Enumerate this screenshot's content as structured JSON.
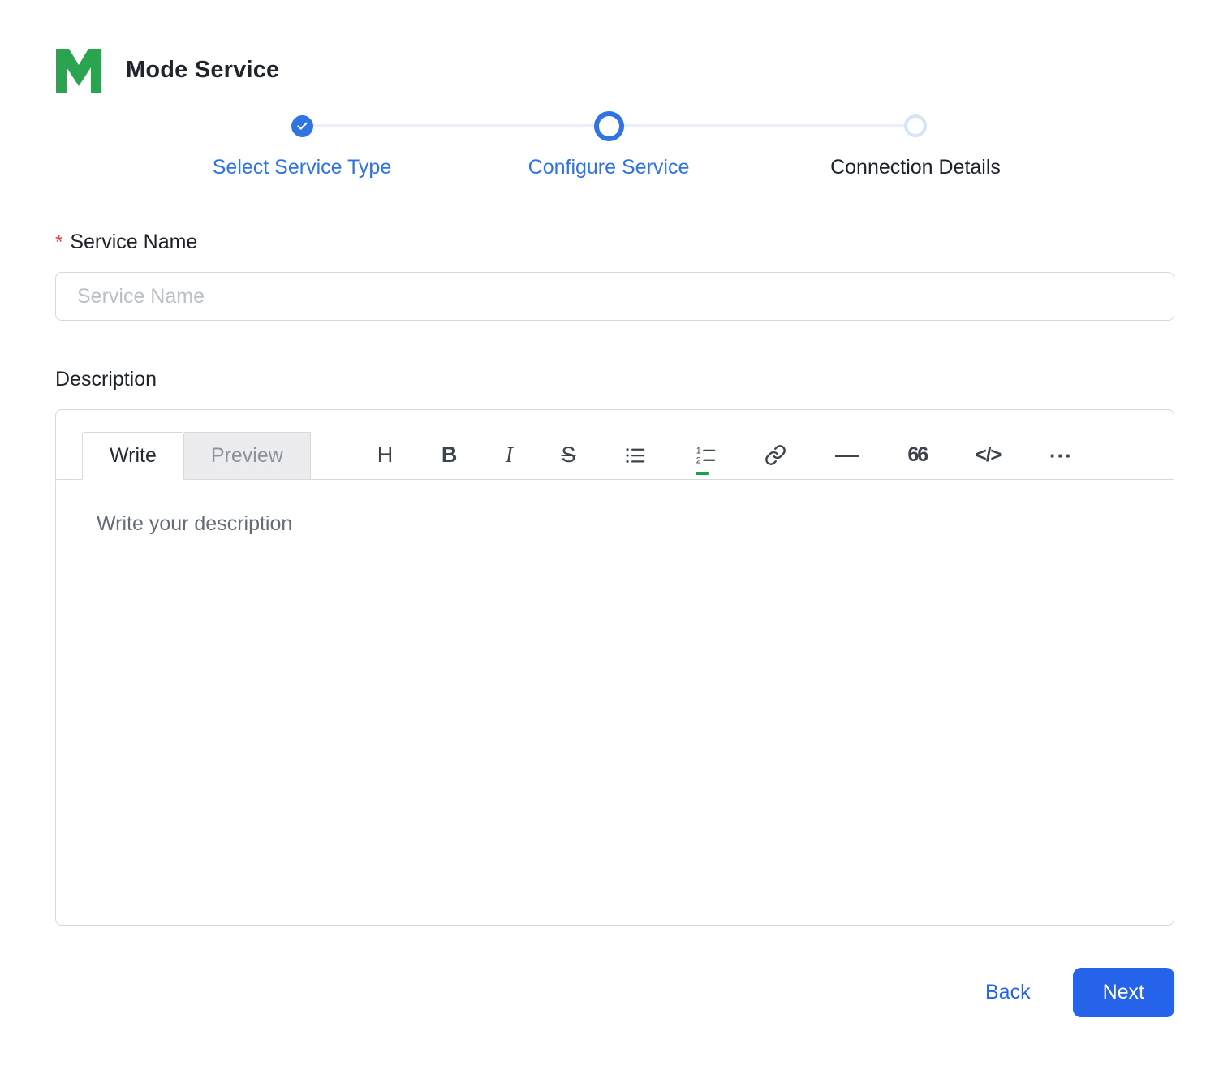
{
  "app": {
    "title": "Mode Service"
  },
  "stepper": {
    "steps": [
      {
        "label": "Select Service Type",
        "state": "completed"
      },
      {
        "label": "Configure Service",
        "state": "active"
      },
      {
        "label": "Connection Details",
        "state": "pending"
      }
    ]
  },
  "form": {
    "service_name": {
      "required_marker": "*",
      "label": "Service Name",
      "placeholder": "Service Name",
      "value": ""
    },
    "description": {
      "label": "Description",
      "editor": {
        "tabs": {
          "write": "Write",
          "preview": "Preview"
        },
        "toolbar": {
          "heading": {
            "icon": "heading-icon",
            "glyph": "H"
          },
          "bold": {
            "icon": "bold-icon",
            "glyph": "B"
          },
          "italic": {
            "icon": "italic-icon",
            "glyph": "I"
          },
          "strikethrough": {
            "icon": "strikethrough-icon",
            "glyph": "S"
          },
          "bullet_list": {
            "icon": "bullet-list-icon"
          },
          "ordered_list": {
            "icon": "ordered-list-icon"
          },
          "link": {
            "icon": "link-icon"
          },
          "horizontal_rule": {
            "icon": "horizontal-rule-icon"
          },
          "quote": {
            "icon": "quote-icon",
            "glyph": "66"
          },
          "code": {
            "icon": "code-icon",
            "glyph": "</>"
          },
          "more": {
            "icon": "more-icon",
            "glyph": "···"
          }
        },
        "placeholder": "Write your description",
        "value": ""
      }
    }
  },
  "actions": {
    "back": "Back",
    "next": "Next"
  },
  "colors": {
    "primary": "#2563eb",
    "stepper_blue": "#2f74e0",
    "logo_green": "#2aa44e",
    "pending_ring": "#d7e4f6",
    "connector": "#e9eef8",
    "border": "#d9d9d9",
    "required_red": "#e5484d",
    "caret_green": "#16a34a"
  }
}
